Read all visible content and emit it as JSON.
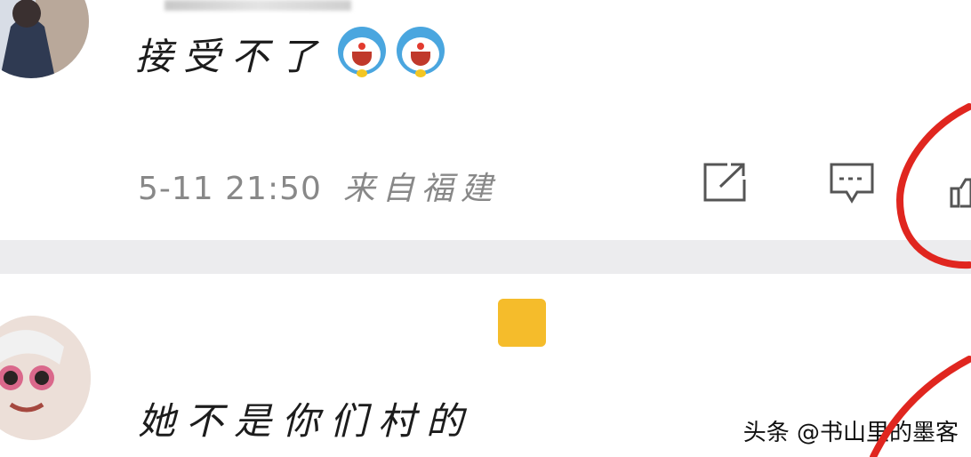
{
  "comments": [
    {
      "text": "接受不了",
      "emoji": [
        "doraemon-laugh-emoji",
        "doraemon-laugh-emoji"
      ],
      "time": "5-11 21:50",
      "location": "来自福建"
    },
    {
      "text": "她不是你们村的"
    }
  ],
  "actions": {
    "share_icon": "share-icon",
    "comment_icon": "comment-icon",
    "like_icon": "thumb-up-icon"
  },
  "watermark": "头条 @书山里的墨客",
  "colors": {
    "background": "#ffffff",
    "separator": "#ececee",
    "meta_text": "#888888",
    "annotation_red": "#e0261f",
    "emoji_blue": "#4aa6df",
    "sticker_yellow": "#f5bc2b"
  }
}
